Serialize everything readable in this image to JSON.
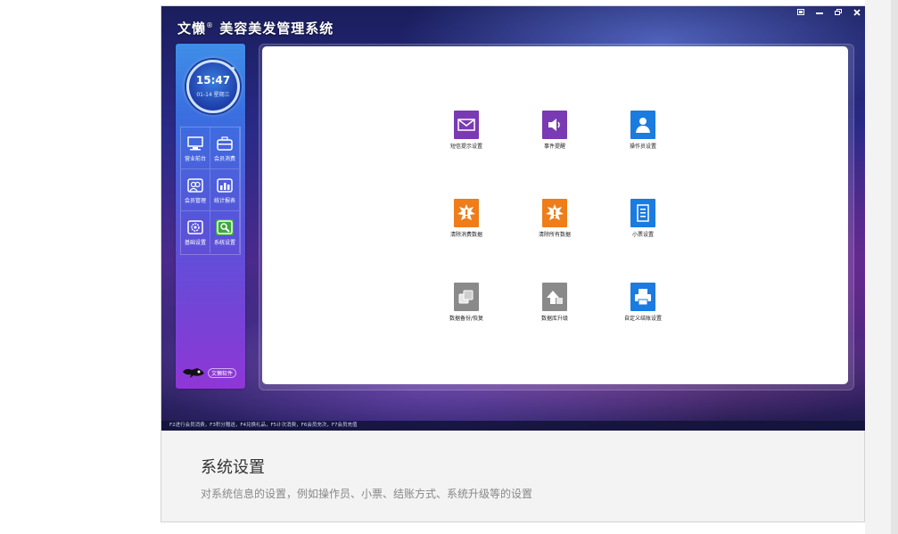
{
  "app": {
    "title_brand": "文懒",
    "title_mark": "®",
    "title_main": "美容美发管理系统"
  },
  "clock": {
    "time": "15:47",
    "date": "01-14 星期三"
  },
  "nav": [
    {
      "label": "营业前台",
      "icon": "monitor-icon"
    },
    {
      "label": "会员消费",
      "icon": "briefcase-icon"
    },
    {
      "label": "会员管理",
      "icon": "members-icon"
    },
    {
      "label": "统计报表",
      "icon": "bar-chart-icon"
    },
    {
      "label": "基础设置",
      "icon": "gear-icon"
    },
    {
      "label": "系统设置",
      "icon": "system-settings-icon",
      "active": true
    }
  ],
  "brand": {
    "label": "文懒软件"
  },
  "tiles": [
    {
      "label": "短信提示设置",
      "icon": "envelope-icon",
      "color": "#7a3ab3"
    },
    {
      "label": "事件提醒",
      "icon": "speaker-icon",
      "color": "#7a3ab3"
    },
    {
      "label": "操作员设置",
      "icon": "user-icon",
      "color": "#1a7be0"
    },
    {
      "label": "清除消费数据",
      "icon": "alert-burst-icon",
      "color": "#ef7d1a"
    },
    {
      "label": "清除所有数据",
      "icon": "alert-burst-icon",
      "color": "#ef7d1a"
    },
    {
      "label": "小票设置",
      "icon": "receipt-icon",
      "color": "#1a7be0"
    },
    {
      "label": "数据备份/恢复",
      "icon": "backup-icon",
      "color": "#8a8a8a"
    },
    {
      "label": "数据库升级",
      "icon": "upgrade-icon",
      "color": "#8a8a8a"
    },
    {
      "label": "自定义结账设置",
      "icon": "printer-icon",
      "color": "#1a7be0"
    }
  ],
  "statusbar": "F2进行会员消费，F3积分赠送，F4兑换礼品，F5计次消费，F6会员充次，F7会员充值",
  "caption": {
    "title": "系统设置",
    "description": "对系统信息的设置，例如操作员、小票、结账方式、系统升级等的设置"
  }
}
